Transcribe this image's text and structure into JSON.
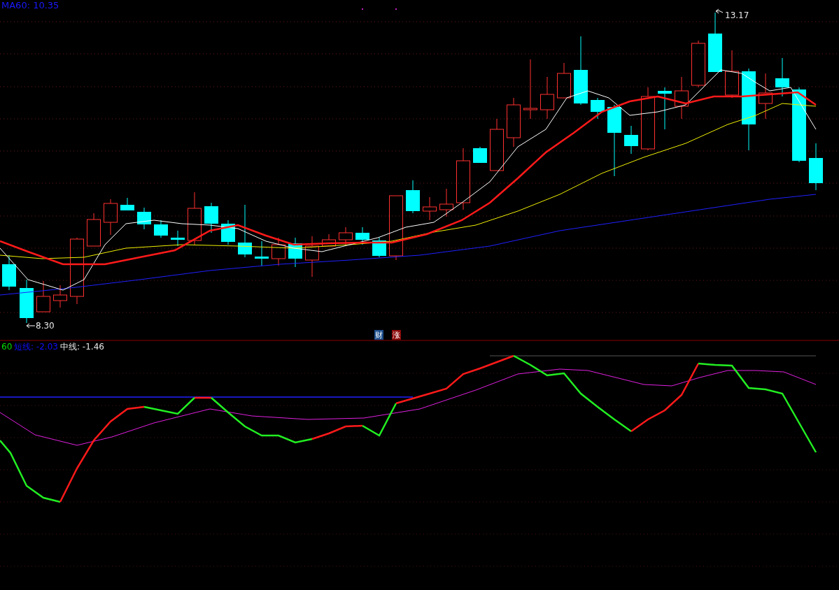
{
  "price_panel": {
    "ma_label": "MA60: 10.35",
    "high_label": "13.17",
    "low_label": "8.30",
    "badges": [
      {
        "text": "财",
        "color": "#1c4f8c"
      },
      {
        "text": "涨",
        "color": "#8c0a0a"
      }
    ]
  },
  "indicator_panel": {
    "legend": [
      {
        "text": "60",
        "color": "#00e000"
      },
      {
        "text": "短线: -2.03",
        "color": "#1010ff"
      },
      {
        "text": "中线: -1.46",
        "color": "#e8e8e8"
      }
    ]
  }
}
